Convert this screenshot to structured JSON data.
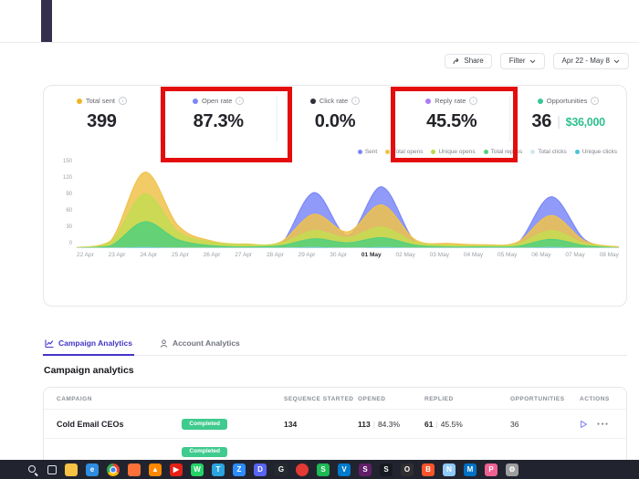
{
  "toolbar": {
    "share": "Share",
    "filter": "Filter",
    "date_range": "Apr 22 - May 8"
  },
  "stats": [
    {
      "label": "Total sent",
      "value": "399",
      "dot": "#f0b429"
    },
    {
      "label": "Open rate",
      "value": "87.3%",
      "dot": "#7b88f8"
    },
    {
      "label": "Click rate",
      "value": "0.0%",
      "dot": "#2f2f3a"
    },
    {
      "label": "Reply rate",
      "value": "45.5%",
      "dot": "#ad7bf5"
    },
    {
      "label": "Opportunities",
      "value": "36",
      "value_secondary": "$36,000",
      "dot": "#38c793"
    }
  ],
  "annotations": {
    "highlight_color": "#e40d0d",
    "highlighted_stats": [
      "Open rate",
      "Reply rate"
    ]
  },
  "legend": [
    {
      "label": "Sent",
      "color": "#7b88f8"
    },
    {
      "label": "Total opens",
      "color": "#f0c24b"
    },
    {
      "label": "Unique opens",
      "color": "#b9d94e"
    },
    {
      "label": "Total replies",
      "color": "#53d07c"
    },
    {
      "label": "Total clicks",
      "color": "#cfe8f2"
    },
    {
      "label": "Unique clicks",
      "color": "#4cc3d9"
    }
  ],
  "chart_data": {
    "type": "area",
    "title": "",
    "xlabel": "",
    "ylabel": "",
    "x": [
      "22 Apr",
      "23 Apr",
      "24 Apr",
      "25 Apr",
      "26 Apr",
      "27 Apr",
      "28 Apr",
      "29 Apr",
      "30 Apr",
      "01 May",
      "02 May",
      "03 May",
      "04 May",
      "05 May",
      "06 May",
      "07 May",
      "08 May"
    ],
    "x_emphasis": [
      "01 May"
    ],
    "ylim": [
      0,
      150
    ],
    "yticks": [
      0,
      30,
      60,
      90,
      120,
      150
    ],
    "grid": false,
    "legend_position": "top-right",
    "series": [
      {
        "name": "Sent",
        "color": "#7b88f8",
        "values": [
          0,
          4,
          30,
          14,
          5,
          3,
          5,
          95,
          22,
          105,
          10,
          5,
          4,
          8,
          88,
          14,
          2
        ]
      },
      {
        "name": "Total opens",
        "color": "#f0c24b",
        "values": [
          1,
          12,
          130,
          38,
          12,
          7,
          10,
          58,
          28,
          74,
          14,
          8,
          6,
          10,
          56,
          12,
          2
        ]
      },
      {
        "name": "Unique opens",
        "color": "#c4dc52",
        "values": [
          1,
          10,
          93,
          28,
          10,
          6,
          8,
          30,
          18,
          36,
          10,
          5,
          4,
          7,
          30,
          8,
          1
        ]
      },
      {
        "name": "Total replies",
        "color": "#53d07c",
        "values": [
          0,
          4,
          45,
          14,
          4,
          2,
          4,
          16,
          9,
          18,
          5,
          2,
          2,
          3,
          15,
          4,
          0
        ]
      },
      {
        "name": "Total clicks",
        "color": "#cfe8f2",
        "values": [
          0,
          0,
          1,
          0,
          0,
          0,
          0,
          1,
          0,
          1,
          0,
          0,
          0,
          0,
          1,
          0,
          0
        ]
      },
      {
        "name": "Unique clicks",
        "color": "#4cc3d9",
        "values": [
          0,
          0,
          1,
          0,
          0,
          0,
          0,
          1,
          0,
          1,
          0,
          0,
          0,
          0,
          1,
          0,
          0
        ]
      }
    ]
  },
  "tabs": [
    {
      "label": "Campaign Analytics",
      "active": true
    },
    {
      "label": "Account Analytics",
      "active": false
    }
  ],
  "section_title": "Campaign analytics",
  "table": {
    "columns": [
      "CAMPAIGN",
      "SEQUENCE STARTED",
      "OPENED",
      "REPLIED",
      "OPPORTUNITIES",
      "ACTIONS"
    ],
    "status_color": "#3fca8e",
    "rows": [
      {
        "campaign": "Cold Email CEOs",
        "status": "Completed",
        "sequence_started": "134",
        "opened": "113",
        "opened_rate": "84.3%",
        "replied": "61",
        "replied_rate": "45.5%",
        "opportunities": "36"
      }
    ],
    "partial_row_status": "Completed"
  },
  "taskbar": {
    "icons": [
      {
        "name": "start",
        "type": "start"
      },
      {
        "name": "search",
        "type": "search"
      },
      {
        "name": "task-view",
        "type": "taskview"
      },
      {
        "name": "file-explorer",
        "color": "#f6c344",
        "glyph": ""
      },
      {
        "name": "edge-browser",
        "color": "#2e8de0",
        "glyph": "e"
      },
      {
        "name": "chrome-browser",
        "type": "chrome"
      },
      {
        "name": "firefox-browser",
        "color": "#ff7139",
        "glyph": ""
      },
      {
        "name": "vlc-player",
        "color": "#ff8800",
        "glyph": "▲"
      },
      {
        "name": "youtube",
        "color": "#e62117",
        "glyph": "▶"
      },
      {
        "name": "whatsapp",
        "color": "#25d366",
        "glyph": "W"
      },
      {
        "name": "telegram",
        "color": "#2aa5e0",
        "glyph": "T"
      },
      {
        "name": "zoom",
        "color": "#2d8cff",
        "glyph": "Z"
      },
      {
        "name": "discord",
        "color": "#5865f2",
        "glyph": "D"
      },
      {
        "name": "github",
        "color": "#24292e",
        "glyph": "G"
      },
      {
        "name": "recording-indicator",
        "color": "#e53935",
        "glyph": "",
        "round": true
      },
      {
        "name": "spotify",
        "color": "#1db954",
        "glyph": "S"
      },
      {
        "name": "vscode",
        "color": "#007acc",
        "glyph": "V"
      },
      {
        "name": "slack",
        "color": "#611f69",
        "glyph": "S"
      },
      {
        "name": "steam",
        "color": "#171a21",
        "glyph": "S"
      },
      {
        "name": "obs",
        "color": "#302e31",
        "glyph": "O"
      },
      {
        "name": "brave",
        "color": "#fb542b",
        "glyph": "B"
      },
      {
        "name": "notepad",
        "color": "#90caf9",
        "glyph": "N"
      },
      {
        "name": "mail",
        "color": "#0072c6",
        "glyph": "M"
      },
      {
        "name": "paint",
        "color": "#f06292",
        "glyph": "P"
      },
      {
        "name": "settings",
        "color": "#9e9e9e",
        "glyph": "⚙"
      }
    ]
  }
}
